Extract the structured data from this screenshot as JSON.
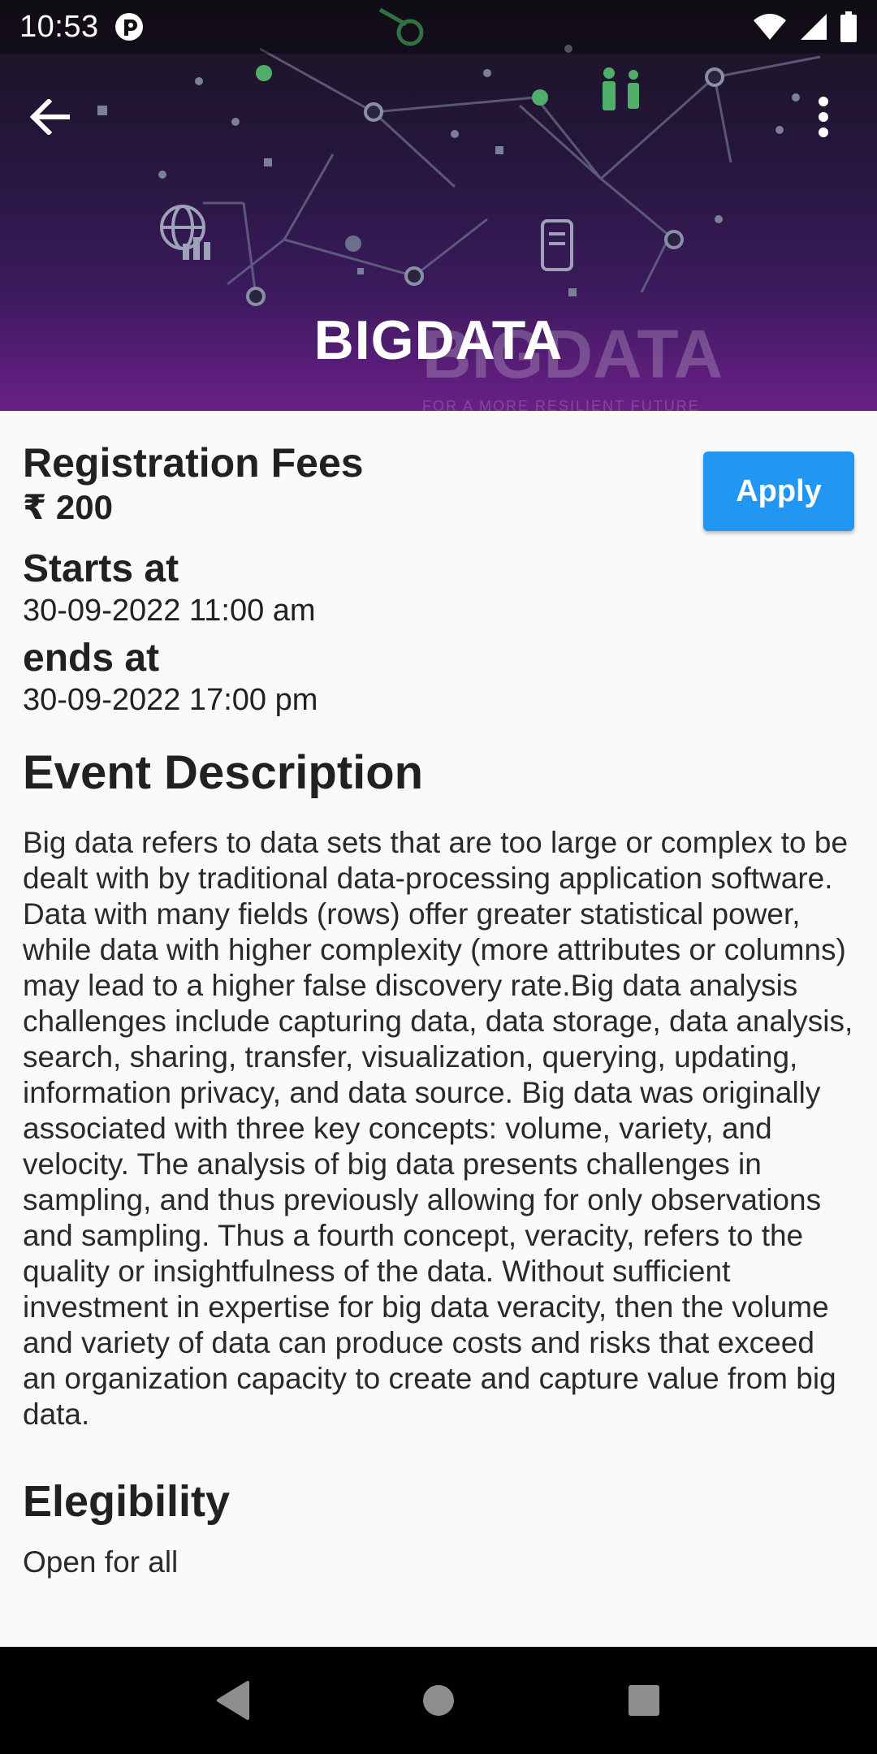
{
  "status_bar": {
    "time": "10:53"
  },
  "header": {
    "title": "BIGDATA",
    "watermark": "BIGDATA",
    "watermark_subtitle": "FOR A MORE RESILIENT FUTURE",
    "icons": {
      "back": "arrow-back-icon",
      "menu": "more-vert-icon"
    }
  },
  "registration": {
    "label": "Registration Fees",
    "amount": "₹ 200",
    "apply_label": "Apply",
    "apply_color": "#2196f3"
  },
  "schedule": {
    "start_label": "Starts at",
    "start_value": "30-09-2022 11:00 am",
    "end_label": "ends at",
    "end_value": "30-09-2022 17:00 pm"
  },
  "description": {
    "title": "Event Description",
    "text": "Big data refers to data sets that are too large or complex to be dealt with by traditional data-processing application software. Data with many fields (rows) offer greater statistical power, while data with higher complexity (more attributes or columns) may lead to a higher false discovery rate.Big data analysis challenges include capturing data, data storage, data analysis, search, sharing, transfer, visualization, querying, updating, information privacy, and data source. Big data was originally associated with three key concepts: volume, variety, and velocity. The analysis of big data presents challenges in sampling, and thus previously allowing for only observations and sampling. Thus a fourth concept, veracity, refers to the quality or insightfulness of the data. Without sufficient investment in expertise for big data veracity, then the volume and variety of data can produce costs and risks that exceed an organization capacity to create and capture value from big data."
  },
  "eligibility": {
    "title": "Elegibility",
    "value": "Open for all"
  },
  "nav_bar": {
    "icons": [
      "back-triangle-icon",
      "home-circle-icon",
      "recents-square-icon"
    ]
  }
}
